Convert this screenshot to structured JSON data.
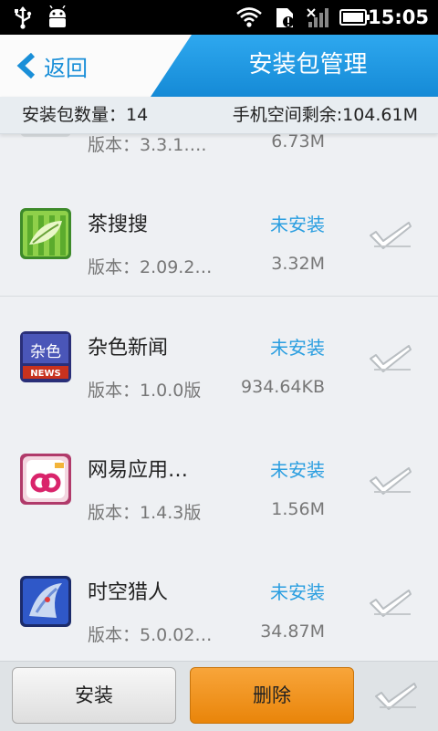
{
  "status_bar": {
    "time": "15:05"
  },
  "header": {
    "back_label": "返回",
    "title": "安装包管理"
  },
  "summary": {
    "count_text": "安装包数量：14",
    "space_text": "手机空间剩余:104.61M"
  },
  "list": {
    "partial_item": {
      "version": "版本：3.3.1….",
      "size": "6.73M"
    },
    "items": [
      {
        "name": "茶搜搜",
        "status": "未安装",
        "version": "版本：2.09.2…",
        "size": "3.32M",
        "icon": "tea-search-app-icon"
      },
      {
        "name": "杂色新闻",
        "status": "未安装",
        "version": "版本：1.0.0版",
        "size": "934.64KB",
        "icon": "news-app-icon",
        "icon_text_top": "杂色",
        "icon_text_bottom": "NEWS"
      },
      {
        "name": "网易应用…",
        "status": "未安装",
        "version": "版本：1.4.3版",
        "size": "1.56M",
        "icon": "netease-app-icon"
      },
      {
        "name": "时空猎人",
        "status": "未安装",
        "version": "版本：5.0.02…",
        "size": "34.87M",
        "icon": "game-app-icon"
      }
    ]
  },
  "bottom_bar": {
    "install_label": "安装",
    "delete_label": "删除"
  },
  "colors": {
    "accent_blue": "#1a8fd8",
    "status_blue": "#2a9ee0",
    "delete_orange": "#f29a24"
  }
}
